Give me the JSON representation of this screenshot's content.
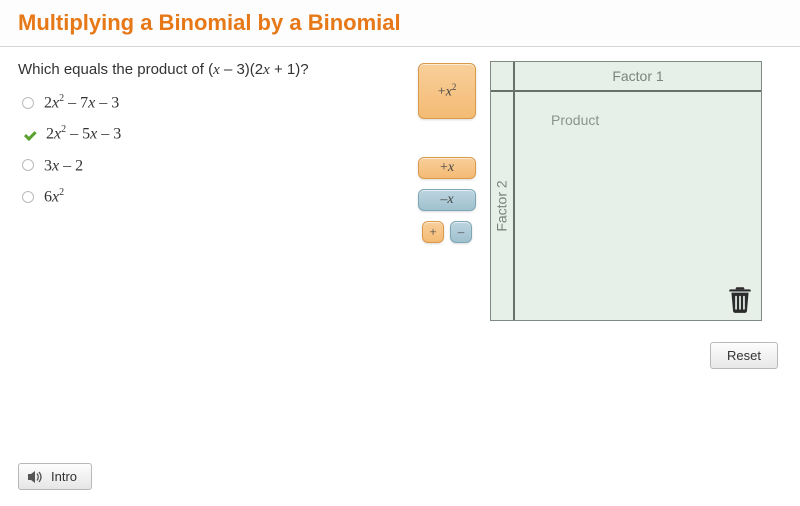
{
  "title": "Multiplying a Binomial by a Binomial",
  "question": {
    "prompt_before": "Which equals the product of  (",
    "x1": "x",
    "mid1": " – 3)(2",
    "x2": "x",
    "after": " + 1)?"
  },
  "options": [
    {
      "coef": "2",
      "var": "x",
      "sq": "2",
      "b": " – 7",
      "var2": "x",
      "c": " – 3",
      "checked": false
    },
    {
      "coef": "2",
      "var": "x",
      "sq": "2",
      "b": " – 5",
      "var2": "x",
      "c": " – 3",
      "checked": true
    },
    {
      "coef": "3",
      "var": "x",
      "sq": "",
      "b": " – 2",
      "var2": "",
      "c": "",
      "checked": false
    },
    {
      "coef": "6",
      "var": "x",
      "sq": "2",
      "b": "",
      "var2": "",
      "c": "",
      "checked": false
    }
  ],
  "tiles": {
    "xx_prefix": "+",
    "xx_var": "x",
    "xx_sup": "2",
    "px_prefix": "+",
    "px_var": "x",
    "nx_prefix": "–",
    "nx_var": "x",
    "plus": "+",
    "minus": "–"
  },
  "board": {
    "factor1": "Factor 1",
    "factor2": "Factor 2",
    "product": "Product"
  },
  "buttons": {
    "reset": "Reset",
    "intro": "Intro"
  }
}
